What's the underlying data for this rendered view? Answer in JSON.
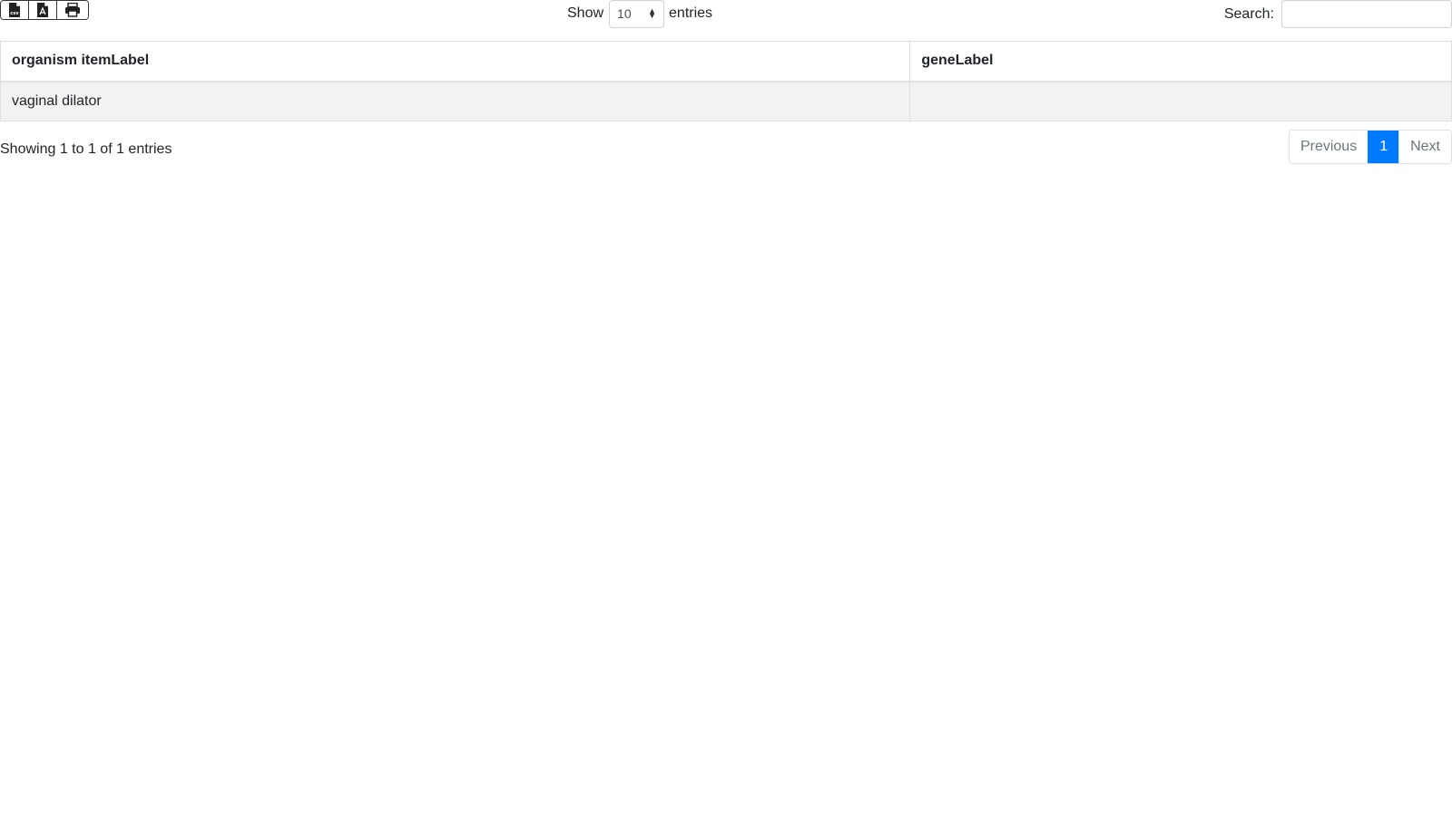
{
  "toolbar": {
    "buttons": [
      {
        "icon": "csv-file-icon"
      },
      {
        "icon": "pdf-file-icon"
      },
      {
        "icon": "print-icon"
      }
    ]
  },
  "length": {
    "prefix": "Show",
    "value": "10",
    "suffix": "entries"
  },
  "search": {
    "label": "Search:",
    "value": "",
    "placeholder": ""
  },
  "table": {
    "columns": [
      "organism itemLabel",
      "geneLabel"
    ],
    "rows": [
      [
        "vaginal dilator",
        ""
      ]
    ]
  },
  "info": "Showing 1 to 1 of 1 entries",
  "pagination": {
    "previous": "Previous",
    "current": "1",
    "next": "Next",
    "active_color": "#007bff"
  }
}
